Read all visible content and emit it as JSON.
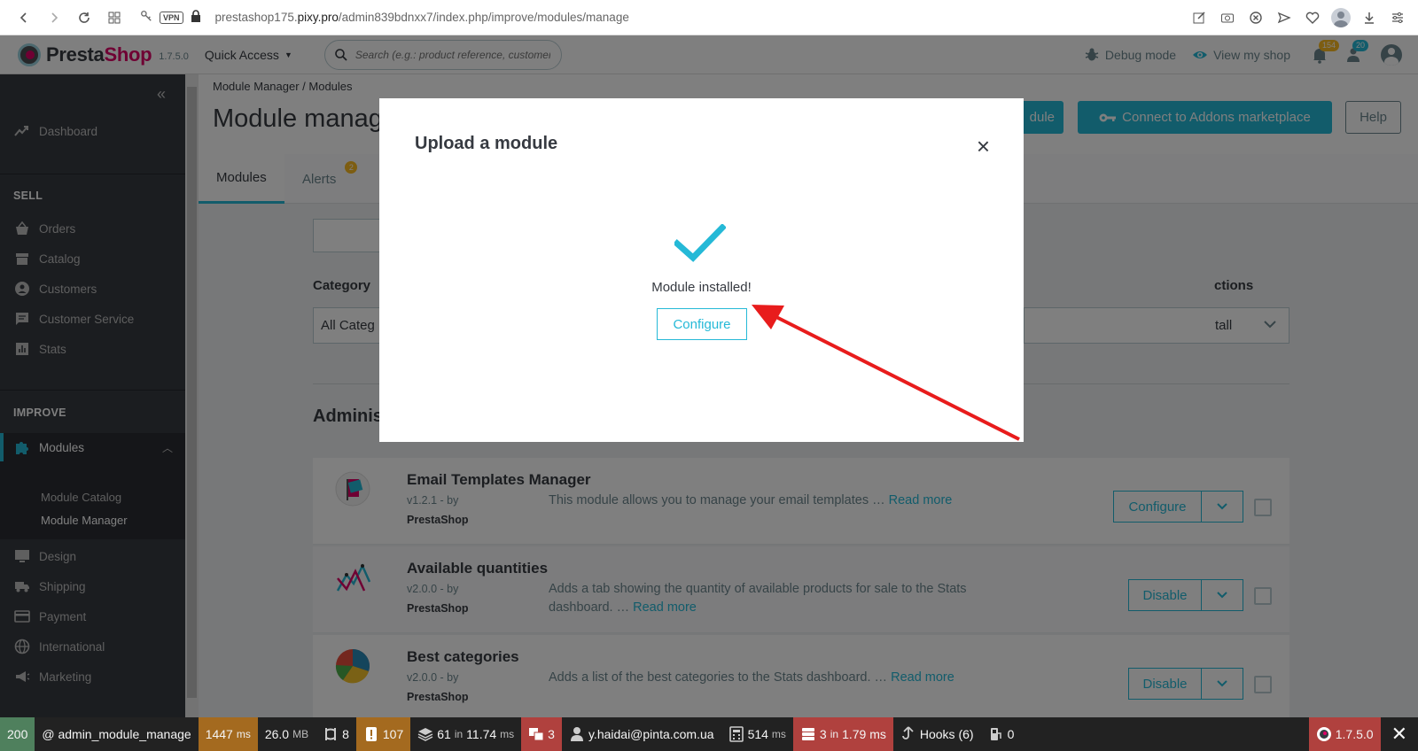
{
  "browser": {
    "url_host": "prestashop175.",
    "url_domain": "pixy.pro",
    "url_path": "/admin839bdnxx7/index.php/improve/modules/manage",
    "vpn_label": "VPN"
  },
  "header": {
    "logo_presta": "Presta",
    "logo_shop": "Shop",
    "version": "1.7.5.0",
    "quick_access": "Quick Access",
    "search_placeholder": "Search (e.g.: product reference, customer name…)",
    "debug_mode": "Debug mode",
    "view_shop": "View my shop",
    "orders_badge": "154",
    "customers_badge": "20"
  },
  "sidebar": {
    "dashboard": "Dashboard",
    "section_sell": "SELL",
    "orders": "Orders",
    "catalog": "Catalog",
    "customers": "Customers",
    "customer_service": "Customer Service",
    "stats": "Stats",
    "section_improve": "IMPROVE",
    "modules": "Modules",
    "module_catalog": "Module Catalog",
    "module_manager": "Module Manager",
    "design": "Design",
    "shipping": "Shipping",
    "payment": "Payment",
    "international": "International",
    "marketing": "Marketing"
  },
  "page": {
    "breadcrumb": "Module Manager  /  Modules",
    "title": "Module manag",
    "upload_btn": "dule",
    "connect_btn": "Connect to Addons marketplace",
    "help_btn": "Help",
    "tab_modules": "Modules",
    "tab_alerts": "Alerts",
    "alerts_count": "2",
    "category_label": "Category",
    "category_value": "All Categ",
    "actions_label": "ctions",
    "actions_value": "tall",
    "section_title": "Administration"
  },
  "modules": [
    {
      "name": "Email Templates Manager",
      "version": "v1.2.1 - by",
      "author": "PrestaShop",
      "description": "This module allows you to manage your email templates … ",
      "read_more": "Read more",
      "action": "Configure"
    },
    {
      "name": "Available quantities",
      "version": "v2.0.0 - by",
      "author": "PrestaShop",
      "description": "Adds a tab showing the quantity of available products for sale to the Stats dashboard. … ",
      "read_more": "Read more",
      "action": "Disable"
    },
    {
      "name": "Best categories",
      "version": "v2.0.0 - by",
      "author": "PrestaShop",
      "description": "Adds a list of the best categories to the Stats dashboard. … ",
      "read_more": "Read more",
      "action": "Disable"
    }
  ],
  "modal": {
    "title": "Upload a module",
    "close": "×",
    "message": "Module installed!",
    "configure_btn": "Configure"
  },
  "debug": {
    "status": "200",
    "route": "@ admin_module_manage",
    "time": "1447",
    "time_unit": "ms",
    "memory": "26.0",
    "memory_unit": "MB",
    "forms": "8",
    "errors": "107",
    "queries": "61",
    "queries_in": "in",
    "queries_time": "11.74",
    "queries_unit": "ms",
    "translations": "3",
    "user": "y.haidai@pinta.com.ua",
    "cache": "514",
    "cache_unit": "ms",
    "db_calls": "3",
    "db_in": "in",
    "db_time": "1.79 ms",
    "hooks": "Hooks (6)",
    "gas": "0",
    "ps_version": "1.7.5.0"
  },
  "colors": {
    "accent": "#25b9d7",
    "sidebar": "#363a41",
    "brand_pink": "#df0067",
    "arrow": "#e81c1c"
  }
}
